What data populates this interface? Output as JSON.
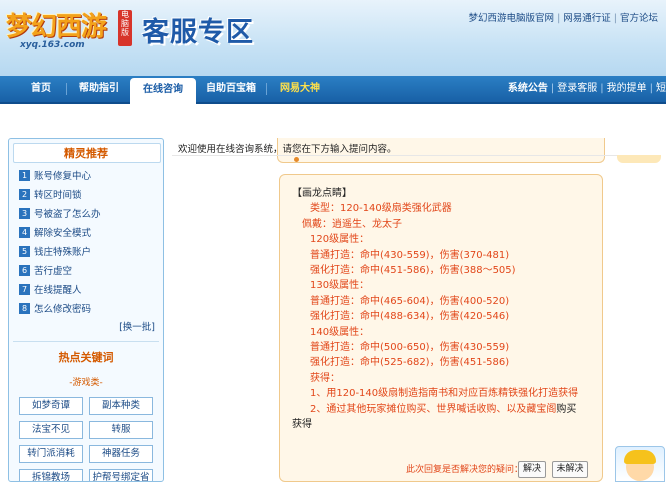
{
  "header": {
    "logo_text": "梦幻西游",
    "logo_badge": "电脑版",
    "logo_url": "xyq.163.com",
    "title": "客服专区",
    "top_links": [
      "梦幻西游电脑版官网",
      "网易通行证",
      "官方论坛"
    ]
  },
  "nav": {
    "items": [
      "首页",
      "帮助指引",
      "在线咨询",
      "自助百宝箱",
      "网易大神"
    ],
    "active_index": 2,
    "right": {
      "system_notice": "系统公告",
      "login": "登录客服",
      "my_ticket": "我的提单",
      "short_msg": "短"
    }
  },
  "sidebar": {
    "title1": "精灵推荐",
    "items": [
      {
        "num": "1",
        "label": "账号修复中心"
      },
      {
        "num": "2",
        "label": "转区时间锁"
      },
      {
        "num": "3",
        "label": "号被盗了怎么办"
      },
      {
        "num": "4",
        "label": "解除安全模式"
      },
      {
        "num": "5",
        "label": "钱庄特殊账户"
      },
      {
        "num": "6",
        "label": "苦行虚空"
      },
      {
        "num": "7",
        "label": "在线提醒人"
      },
      {
        "num": "8",
        "label": "怎么修改密码"
      }
    ],
    "more": "[换一批]",
    "title2": "热点关键词",
    "game_category": "-游戏类-",
    "keywords": [
      "如梦奇谭",
      "副本种类",
      "法宝不见",
      "转服",
      "转门派消耗",
      "神器任务",
      "拆锦教场",
      "护帮号绑定省"
    ]
  },
  "chat": {
    "notice": "欢迎使用在线咨询系统，请您在下方输入提问内容。",
    "answer": {
      "title": "【画龙点睛】",
      "lines": [
        "类型：120-140级扇类强化武器",
        "佩戴：逍遥生、龙太子",
        "120级属性：",
        "普通打造：命中(430-559)，伤害(370-481)",
        "强化打造：命中(451-586)，伤害(388～505)",
        "130级属性：",
        "普通打造：命中(465-604)，伤害(400-520)",
        "强化打造：命中(488-634)，伤害(420-546)",
        "140级属性：",
        "普通打造：命中(500-650)，伤害(430-559)",
        "强化打造：命中(525-682)，伤害(451-586)",
        "获得：",
        "1、用120-140级扇制造指南书和对应百炼精铁强化打造获得",
        "2、通过其他玩家摊位购买、世界喊话收购、以及藏宝阁",
        "购买",
        "获得"
      ]
    },
    "feedback": {
      "question": "此次回复是否解决您的疑问：",
      "solved": "解决",
      "unsolved": "未解决"
    }
  }
}
